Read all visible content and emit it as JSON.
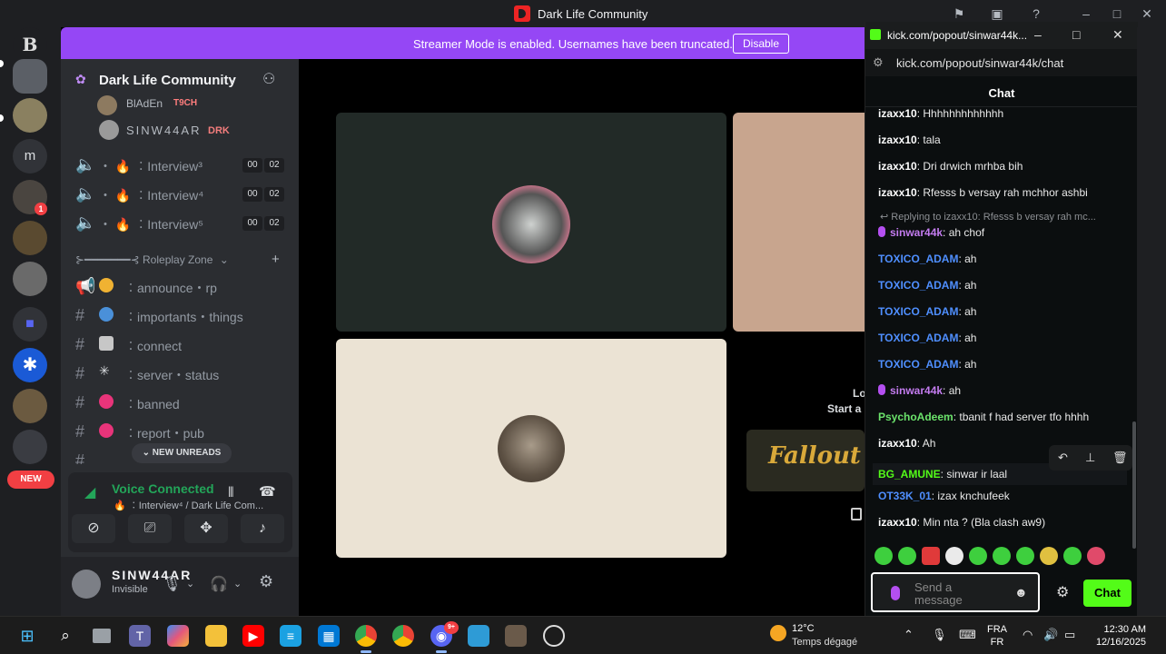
{
  "window": {
    "title": "Dark Life Community"
  },
  "banner": {
    "text": "Streamer Mode is enabled. Usernames have been truncated.",
    "button": "Disable"
  },
  "rail": {
    "letter_server": "m",
    "new_label": "NEW",
    "badge_count": "1"
  },
  "guild": {
    "name": "Dark Life Community",
    "voice_users": [
      {
        "name": "BlAdEn",
        "tag": "T9CH"
      },
      {
        "name": "SINW44AR",
        "tag": "DRK"
      }
    ],
    "voice_channels": [
      {
        "label": "・ 🔥 ︰Interview³",
        "a": "00",
        "b": "02"
      },
      {
        "label": "・ 🔥 ︰Interview⁴",
        "a": "00",
        "b": "02"
      },
      {
        "label": "・ 🔥 ︰Interview⁵",
        "a": "00",
        "b": "02"
      }
    ],
    "category": "⊱━━━━━━━⊰ Roleplay Zone",
    "text_channels": [
      {
        "label": "︰announce・rp"
      },
      {
        "label": "︰importants・things"
      },
      {
        "label": "︰connect"
      },
      {
        "label": "︰server・status"
      },
      {
        "label": "︰banned"
      },
      {
        "label": "︰report・pub"
      }
    ],
    "new_unreads": "NEW UNREADS"
  },
  "voice": {
    "title": "Voice Connected",
    "subtitle": "🔥 ︰Interview⁴ / Dark Life Com..."
  },
  "user": {
    "name": "SINW44AR",
    "status": "Invisible"
  },
  "stage": {
    "tile_text_1": "Lo",
    "tile_text_2": "Start a",
    "fallout": "Fallout"
  },
  "kick": {
    "tab_title": "kick.com/popout/sinwar44k...",
    "url": "kick.com/popout/sinwar44k/chat",
    "header": "Chat",
    "messages": [
      {
        "user": "izaxx10",
        "text": "Hhhhhhhhhhhhh",
        "color": "#ffffff"
      },
      {
        "user": "izaxx10",
        "text": "tala",
        "color": "#ffffff"
      },
      {
        "user": "izaxx10",
        "text": "Dri drwich mrhba bih",
        "color": "#ffffff"
      },
      {
        "user": "izaxx10",
        "text": "Rfesss b versay rah mchhor ashbi",
        "color": "#ffffff"
      },
      {
        "user": "sinwar44k",
        "text": "ah chof",
        "color": "#c47cf0"
      },
      {
        "user": "TOXICO_ADAM",
        "text": "ah",
        "color": "#4f8fff"
      },
      {
        "user": "TOXICO_ADAM",
        "text": "ah",
        "color": "#4f8fff"
      },
      {
        "user": "TOXICO_ADAM",
        "text": "ah",
        "color": "#4f8fff"
      },
      {
        "user": "TOXICO_ADAM",
        "text": "ah",
        "color": "#4f8fff"
      },
      {
        "user": "TOXICO_ADAM",
        "text": "ah",
        "color": "#4f8fff"
      },
      {
        "user": "sinwar44k",
        "text": "ah",
        "color": "#c47cf0"
      },
      {
        "user": "PsychoAdeem",
        "text": "tbanit f had server tfo hhhh",
        "color": "#6be36b"
      },
      {
        "user": "izaxx10",
        "text": "Ah",
        "color": "#ffffff"
      },
      {
        "user": "BG_AMUNE",
        "text": "sinwar ir laal",
        "color": "#53fc18"
      },
      {
        "user": "OT33K_01",
        "text": "izax knchufeek",
        "color": "#4f8fff"
      },
      {
        "user": "izaxx10",
        "text": "Min nta ? (Bla clash aw9)",
        "color": "#ffffff"
      }
    ],
    "reply_note": "↩ Replying to izaxx10: Rfesss b versay rah mc...",
    "input_placeholder": "Send a message",
    "chat_button": "Chat"
  },
  "taskbar": {
    "temp": "12°C",
    "weather": "Temps dégagé",
    "lang_1": "FRA",
    "lang_2": "FR",
    "time": "12:30 AM",
    "date": "12/16/2025",
    "discord_badge": "9+"
  },
  "colors": {
    "accent": "#9547f5",
    "kick_green": "#53fc18",
    "voice_green": "#23a559"
  }
}
